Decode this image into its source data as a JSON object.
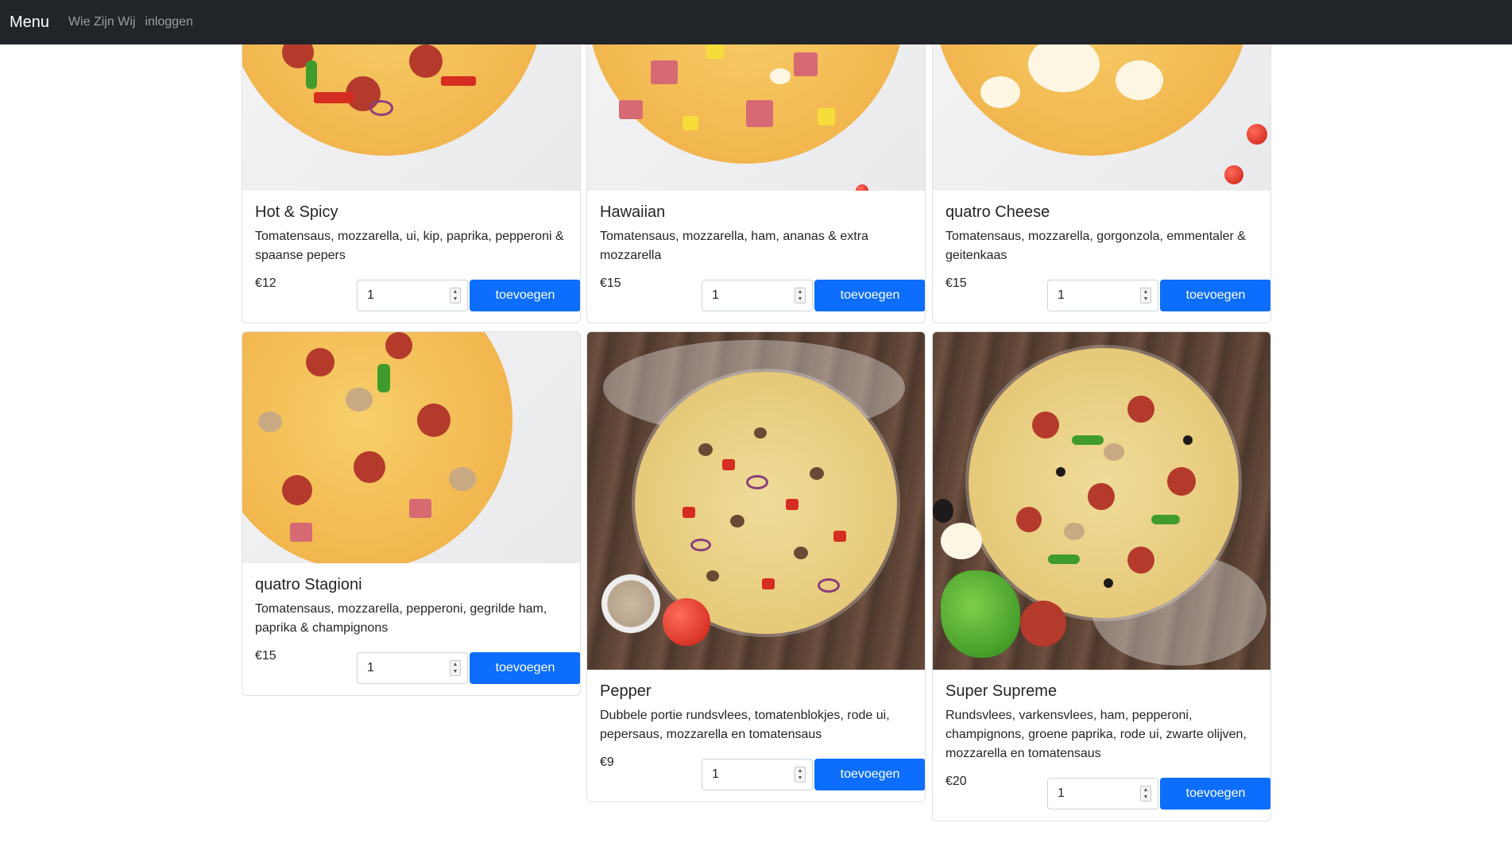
{
  "nav": {
    "brand": "Menu",
    "links": [
      "Wie Zijn Wij",
      "inloggen"
    ]
  },
  "products": [
    {
      "name": "Hot & Spicy",
      "description": "Tomatensaus, mozzarella, ui, kip, paprika, pepperoni & spaanse pepers",
      "price": "€12",
      "quantity": "1",
      "button": "toevoegen"
    },
    {
      "name": "Hawaiian",
      "description": "Tomatensaus, mozzarella, ham, ananas & extra mozzarella",
      "price": "€15",
      "quantity": "1",
      "button": "toevoegen"
    },
    {
      "name": "quatro Cheese",
      "description": "Tomatensaus, mozzarella, gorgonzola, emmentaler & geitenkaas",
      "price": "€15",
      "quantity": "1",
      "button": "toevoegen"
    },
    {
      "name": "quatro Stagioni",
      "description": "Tomatensaus, mozzarella, pepperoni, gegrilde ham, paprika & champignons",
      "price": "€15",
      "quantity": "1",
      "button": "toevoegen"
    },
    {
      "name": "Pepper",
      "description": "Dubbele portie rundsvlees, tomatenblokjes, rode ui, pepersaus, mozzarella en tomatensaus",
      "price": "€9",
      "quantity": "1",
      "button": "toevoegen"
    },
    {
      "name": "Super Supreme",
      "description": "Rundsvlees, varkensvlees, ham, pepperoni, champignons, groene paprika, rode ui, zwarte olijven, mozzarella en tomatensaus",
      "price": "€20",
      "quantity": "1",
      "button": "toevoegen"
    }
  ],
  "colors": {
    "navbar": "#212529",
    "button": "#0d6efd",
    "nav_link": "#8c8f93"
  }
}
